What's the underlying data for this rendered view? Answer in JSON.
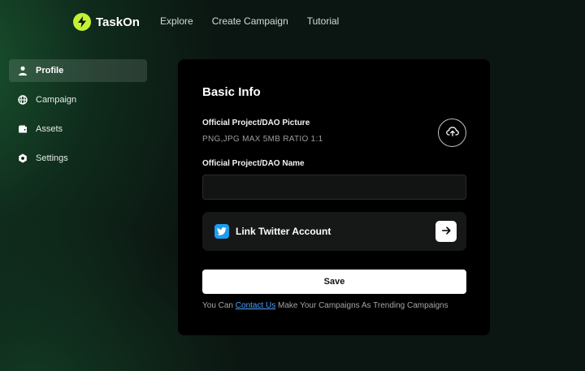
{
  "brand": {
    "name": "TaskOn",
    "logo_icon": "lightning-bolt-icon",
    "accent": "#c4f035"
  },
  "nav": {
    "items": [
      {
        "label": "Explore"
      },
      {
        "label": "Create Campaign"
      },
      {
        "label": "Tutorial"
      }
    ]
  },
  "sidebar": {
    "items": [
      {
        "label": "Profile",
        "icon": "user-icon",
        "active": true
      },
      {
        "label": "Campaign",
        "icon": "globe-icon",
        "active": false
      },
      {
        "label": "Assets",
        "icon": "wallet-icon",
        "active": false
      },
      {
        "label": "Settings",
        "icon": "gear-icon",
        "active": false
      }
    ]
  },
  "basic_info": {
    "title": "Basic Info",
    "picture_label": "Official Project/DAO Picture",
    "picture_hint": "PNG,JPG MAX 5MB RATIO 1:1",
    "upload_icon": "cloud-upload-icon",
    "name_label": "Official Project/DAO Name",
    "name_value": "",
    "name_placeholder": "",
    "twitter_label": "Link Twitter Account",
    "twitter_icon": "twitter-icon",
    "twitter_brand_color": "#1d9bf0",
    "arrow_icon": "arrow-right-icon",
    "save_label": "Save",
    "footer_prefix": "You Can ",
    "footer_link": "Contact Us",
    "footer_suffix": " Make Your Campaigns As Trending Campaigns",
    "link_color": "#4ea2ff"
  }
}
